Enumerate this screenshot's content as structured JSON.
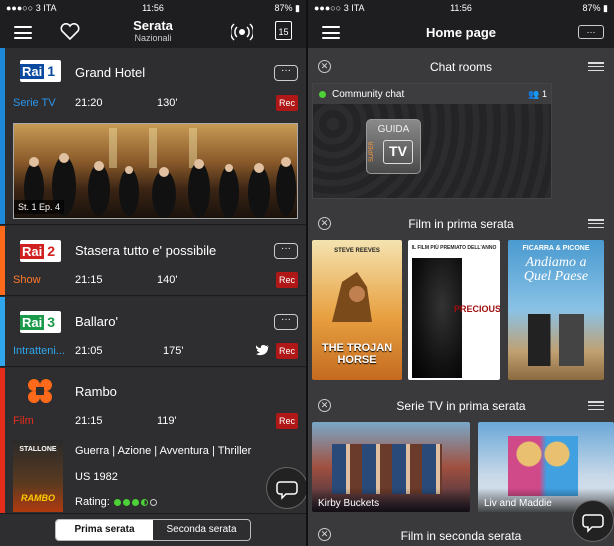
{
  "left": {
    "status": {
      "carrier": "3 ITA",
      "time": "11:56",
      "battery": "87%"
    },
    "nav": {
      "title": "Serata",
      "subtitle": "Nazionali",
      "calendar_day": "15"
    },
    "programs": [
      {
        "channel": "Rai 1",
        "title": "Grand Hotel",
        "genre": "Serie TV",
        "time": "21:20",
        "duration": "130'",
        "rec": "Rec",
        "episode": "St. 1 Ep. 4",
        "stripe": "#1e88d8",
        "genre_color": "#2a97f0"
      },
      {
        "channel": "Rai 2",
        "title": "Stasera tutto e' possibile",
        "genre": "Show",
        "time": "21:15",
        "duration": "140'",
        "rec": "Rec",
        "stripe": "#ff6a1a",
        "genre_color": "#ff7a2a"
      },
      {
        "channel": "Rai 3",
        "title": "Ballaro'",
        "genre": "Intratteni...",
        "time": "21:05",
        "duration": "175'",
        "rec": "Rec",
        "stripe": "#2fa6ee",
        "genre_color": "#2fa6ee"
      },
      {
        "channel": "Rai 4",
        "title": "Rambo",
        "genre": "Film",
        "time": "21:15",
        "duration": "119'",
        "rec": "Rec",
        "details": "Guerra | Azione | Avventura | Thriller",
        "origin": "US 1982",
        "rating_label": "Rating:",
        "rating": 3.5,
        "stripe": "#e52d1c",
        "genre_color": "#e52d1c"
      }
    ],
    "segments": {
      "first": "Prima serata",
      "second": "Seconda serata"
    }
  },
  "right": {
    "status": {
      "carrier": "3 ITA",
      "time": "11:56",
      "battery": "87%"
    },
    "nav": {
      "title": "Home page",
      "more": "···"
    },
    "chat": {
      "section": "Chat rooms",
      "room": "Community chat",
      "users": "1",
      "logo_top": "GUIDA",
      "logo_side": "SUPER",
      "logo_bottom": "TV"
    },
    "films": {
      "section": "Film in prima serata",
      "posters": [
        {
          "top": "STEVE REEVES",
          "title": "THE TROJAN HORSE"
        },
        {
          "top": "IL FILM PIÙ PREMIATO DELL'ANNO",
          "title": "PRECIOUS"
        },
        {
          "top": "FICARRA & PICONE",
          "title": "Andiamo a Quel Paese"
        }
      ]
    },
    "series": {
      "section": "Serie TV in prima serata",
      "items": [
        {
          "title": "Kirby Buckets"
        },
        {
          "title": "Liv and Maddie"
        }
      ]
    },
    "late": {
      "section": "Film in seconda serata"
    }
  }
}
